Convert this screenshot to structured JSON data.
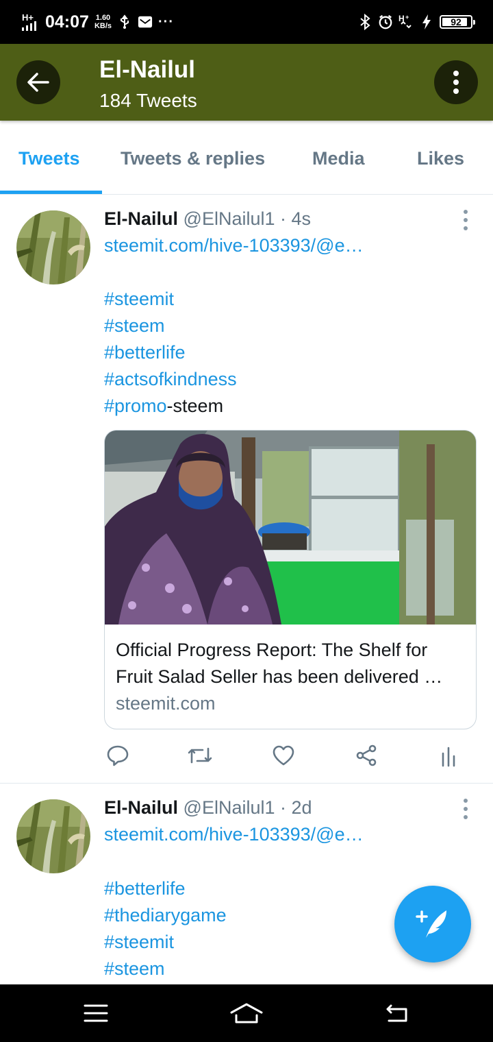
{
  "status_bar": {
    "network": "H+",
    "time": "04:07",
    "speed_value": "1.60",
    "speed_unit": "KB/s",
    "battery": "92",
    "battery_level_percent": 92,
    "icons": [
      "signal-icon",
      "usb-icon",
      "mail-icon",
      "more-dots-icon",
      "bluetooth-icon",
      "alarm-icon",
      "data-hplus-icon",
      "charging-icon",
      "battery-icon"
    ]
  },
  "header": {
    "title": "El-Nailul",
    "subtitle": "184 Tweets",
    "bar_color": "#4e5e16",
    "icons": [
      "back-arrow-icon",
      "more-vertical-icon"
    ]
  },
  "tabs": [
    {
      "label": "Tweets",
      "active": true
    },
    {
      "label": "Tweets & replies",
      "active": false
    },
    {
      "label": "Media",
      "active": false
    },
    {
      "label": "Likes",
      "active": false
    }
  ],
  "accent_color": "#1da1f2",
  "tweets": [
    {
      "name": "El-Nailul",
      "meta": "@ElNailul1 · 4s",
      "link": "steemit.com/hive-103393/@e…",
      "hashtags": [
        "#steemit",
        "#steem",
        "#betterlife",
        "#actsofkindness"
      ],
      "last_tag": "#promo",
      "last_suffix": "-steem",
      "card": {
        "title_line1": "Official Progress Report: The Shelf for",
        "title_line2": "Fruit Salad Seller has been delivered …",
        "domain": "steemit.com"
      },
      "actions": [
        "reply-icon",
        "retweet-icon",
        "like-icon",
        "share-icon",
        "analytics-icon"
      ]
    },
    {
      "name": "El-Nailul",
      "meta": "@ElNailul1 · 2d",
      "link": "steemit.com/hive-103393/@e…",
      "hashtags": [
        "#betterlife",
        "#thediarygame",
        "#steemit",
        "#steem"
      ]
    }
  ],
  "fab": {
    "icon": "compose-tweet-icon"
  },
  "nav_bar": {
    "icons": [
      "menu-icon",
      "home-icon",
      "back-icon"
    ]
  }
}
